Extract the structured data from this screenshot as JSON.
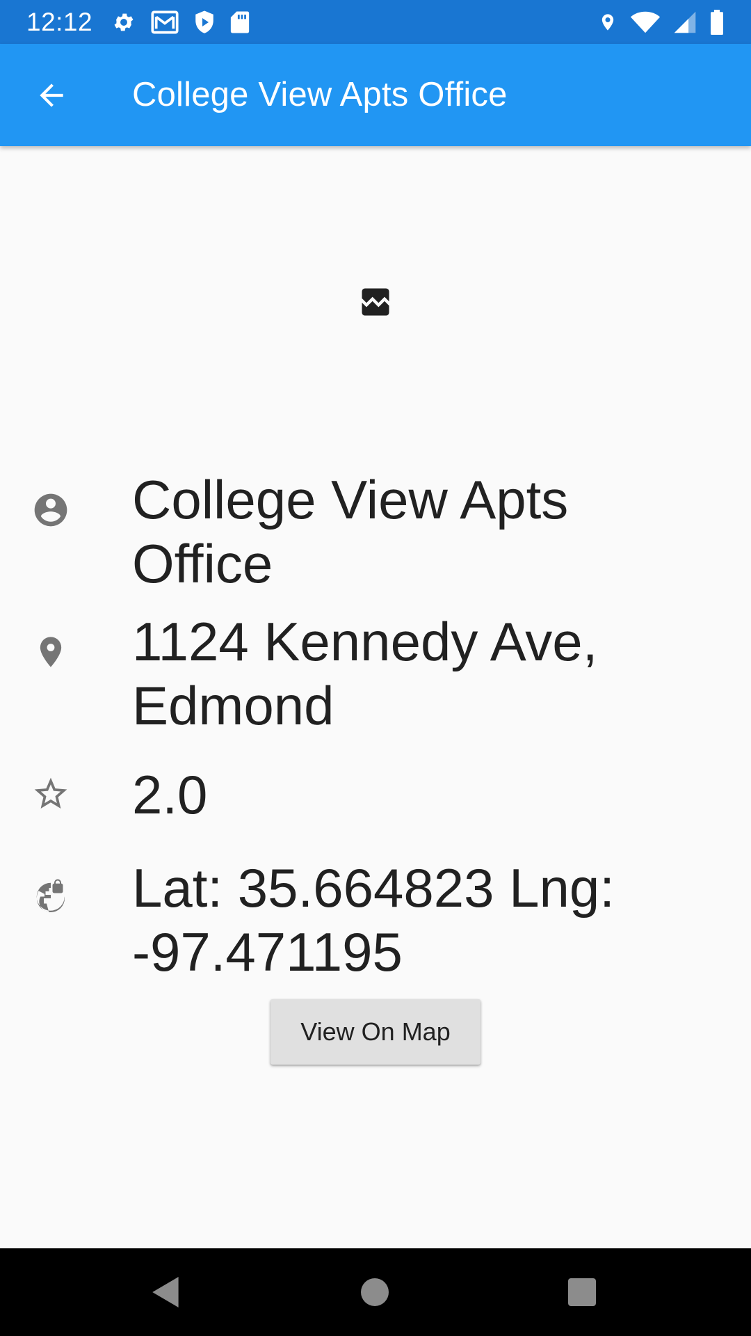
{
  "status_bar": {
    "time": "12:12",
    "left_icons": [
      "gear-icon",
      "gmail-icon",
      "shield-icon",
      "sd-card-icon"
    ],
    "right_icons": [
      "location-pin-icon",
      "wifi-icon",
      "signal-icon",
      "battery-icon"
    ]
  },
  "app_bar": {
    "title": "College View Apts Office",
    "back_icon": "arrow-back-icon"
  },
  "place": {
    "image_icon": "broken-image-icon",
    "name": "College View Apts Office",
    "address": "1124 Kennedy Ave, Edmond",
    "rating": "2.0",
    "coordinates": "Lat: 35.664823 Lng: -97.471195"
  },
  "actions": {
    "view_on_map_label": "View On Map"
  },
  "nav_bar": {
    "icons": [
      "nav-back-icon",
      "nav-home-icon",
      "nav-recents-icon"
    ]
  },
  "colors": {
    "status_bar": "#1976d2",
    "app_bar": "#2196f3",
    "background": "#fafafa",
    "icon_gray": "#757575",
    "button_bg": "#e0e0e0"
  }
}
